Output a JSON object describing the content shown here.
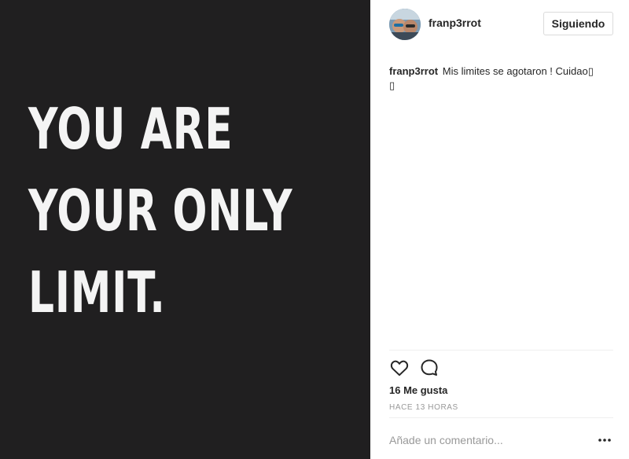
{
  "image": {
    "quote_lines": [
      "YOU ARE",
      "YOUR ONLY",
      "LIMIT."
    ]
  },
  "header": {
    "username": "franp3rrot",
    "follow_label": "Siguiendo"
  },
  "caption": {
    "username": "franp3rrot",
    "text": "Mis limites se agotaron ! Cuidao▯\n▯"
  },
  "actions": {
    "like_icon": "heart-outline-icon",
    "comment_icon": "comment-bubble-icon"
  },
  "stats": {
    "likes": "16 Me gusta",
    "time": "HACE 13 HORAS"
  },
  "comment": {
    "placeholder": "Añade un comentario..."
  },
  "colors": {
    "image_bg": "#201f20",
    "quote_text": "#f4f4f4",
    "text": "#262626",
    "muted": "#999999",
    "border": "#dbdbdb"
  }
}
